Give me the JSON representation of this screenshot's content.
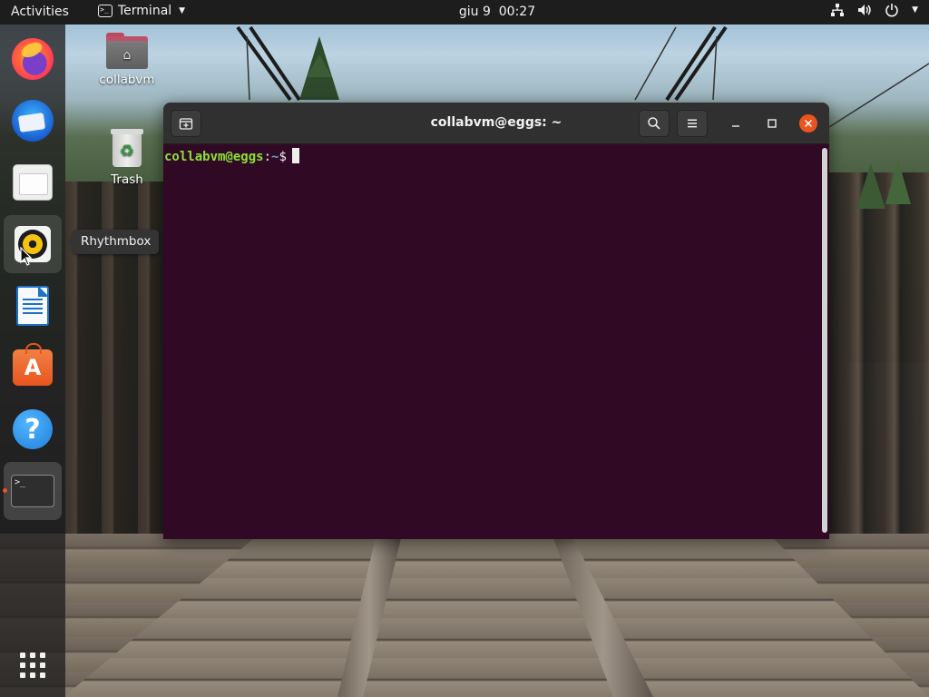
{
  "topbar": {
    "activities": "Activities",
    "app_name": "Terminal",
    "app_icon_glyph": ">_",
    "clock": "giu 9  00:27",
    "status_icons": [
      "network-icon",
      "volume-icon",
      "power-icon",
      "chevron-down-icon"
    ]
  },
  "dock": {
    "items": [
      {
        "name": "Firefox",
        "icon": "firefox-icon"
      },
      {
        "name": "Thunderbird",
        "icon": "thunderbird-icon"
      },
      {
        "name": "Files",
        "icon": "files-icon"
      },
      {
        "name": "Rhythmbox",
        "icon": "rhythmbox-icon"
      },
      {
        "name": "LibreOffice Writer",
        "icon": "writer-icon"
      },
      {
        "name": "Ubuntu Software",
        "icon": "software-icon"
      },
      {
        "name": "Help",
        "icon": "help-icon"
      },
      {
        "name": "Terminal",
        "icon": "terminal-icon",
        "running": true
      }
    ],
    "terminal_glyph": ">_",
    "help_glyph": "?",
    "software_glyph": "A",
    "show_apps_icon": "app-grid-icon",
    "tooltip": "Rhythmbox"
  },
  "desktop": {
    "icons": [
      {
        "label": "collabvm",
        "icon": "home-folder-icon"
      },
      {
        "label": "Trash",
        "icon": "trash-icon"
      }
    ],
    "trash_glyph": "♻",
    "home_glyph": "⌂"
  },
  "terminal": {
    "title": "collabvm@eggs: ~",
    "prompt_user": "collabvm@eggs",
    "prompt_colon": ":",
    "prompt_path": "~",
    "prompt_sign": "$",
    "colors": {
      "background": "#300a24",
      "headerbar": "#303030",
      "prompt_user": "#8ae234",
      "prompt_path": "#729fcf",
      "close_button": "#e95420"
    },
    "buttons": [
      "new-tab-icon",
      "search-icon",
      "hamburger-menu-icon",
      "minimize-icon",
      "maximize-icon",
      "close-icon"
    ]
  }
}
